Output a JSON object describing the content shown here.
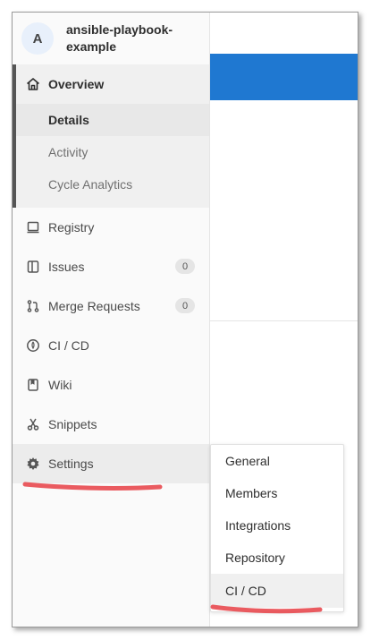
{
  "project": {
    "avatar_letter": "A",
    "name": "ansible-playbook-example"
  },
  "nav": {
    "overview": {
      "label": "Overview",
      "icon": "home-icon"
    },
    "overview_sub": [
      {
        "label": "Details",
        "active": true
      },
      {
        "label": "Activity",
        "active": false
      },
      {
        "label": "Cycle Analytics",
        "active": false
      }
    ],
    "items": [
      {
        "key": "registry",
        "label": "Registry",
        "icon": "container-registry-icon"
      },
      {
        "key": "issues",
        "label": "Issues",
        "icon": "issues-icon",
        "badge": "0"
      },
      {
        "key": "merge-requests",
        "label": "Merge Requests",
        "icon": "merge-request-icon",
        "badge": "0"
      },
      {
        "key": "ci-cd",
        "label": "CI / CD",
        "icon": "rocket-icon"
      },
      {
        "key": "wiki",
        "label": "Wiki",
        "icon": "book-icon"
      },
      {
        "key": "snippets",
        "label": "Snippets",
        "icon": "scissors-icon"
      },
      {
        "key": "settings",
        "label": "Settings",
        "icon": "gear-icon"
      }
    ]
  },
  "settings_flyout": [
    "General",
    "Members",
    "Integrations",
    "Repository",
    "CI / CD"
  ],
  "colors": {
    "header_blue": "#1f78d1",
    "annotation_red": "#e8494f"
  }
}
